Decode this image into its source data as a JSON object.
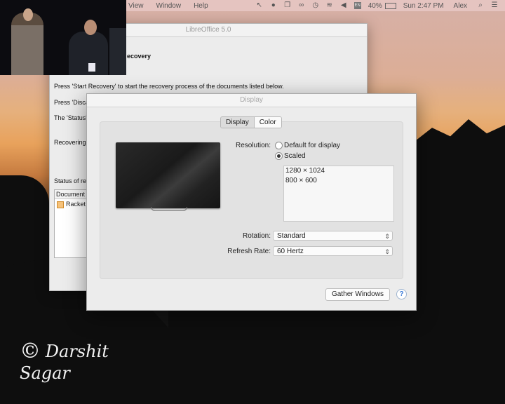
{
  "menubar": {
    "items": [
      "View",
      "Window",
      "Help"
    ],
    "battery": "40%",
    "clock": "Sun 2:47 PM",
    "user": "Alex",
    "icons": [
      "status-icon-a",
      "status-icon-b",
      "status-icon-c",
      "glasses-icon",
      "time-machine-icon",
      "wifi-icon",
      "volume-icon",
      "input-icon",
      "battery-icon",
      "search-icon",
      "list-icon"
    ]
  },
  "libreoffice": {
    "title": "LibreOffice 5.0",
    "heading": "ecovery",
    "line1": "Press 'Start Recovery' to start the recovery process of the documents listed below.",
    "line2": "Press 'Disca",
    "line3": "The 'Status'",
    "line4": "Recovering",
    "status_label": "Status of re",
    "list_header": "Document",
    "list_item": "Racket"
  },
  "display": {
    "title": "Display",
    "tabs": [
      "Display",
      "Color"
    ],
    "active_tab": "Display",
    "resolution_label": "Resolution:",
    "options": [
      "Default for display",
      "Scaled"
    ],
    "selected_option": "Scaled",
    "resolutions": [
      "1280 × 1024",
      "800 × 600"
    ],
    "rotation_label": "Rotation:",
    "rotation_value": "Standard",
    "refresh_label": "Refresh Rate:",
    "refresh_value": "60 Hertz",
    "gather_label": "Gather Windows",
    "help_label": "?"
  },
  "watermark": {
    "symbol": "©",
    "text": "Darshit Sagar"
  }
}
